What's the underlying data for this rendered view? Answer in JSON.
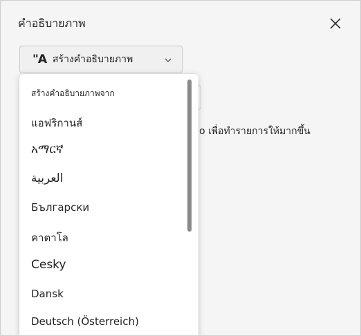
{
  "pane": {
    "title": "คำอธิบายภาพ",
    "close_icon": "close-icon"
  },
  "generate_button": {
    "icon_text": "\"A",
    "label": "สร้างคำอธิบายภาพ",
    "chevron_icon": "chevron-down-icon"
  },
  "background_text": "o เพื่อทำรายการให้มากขึ้น",
  "language_menu": {
    "header": "สร้างคำอธิบายภาพจาก",
    "items": [
      "แอฟริกานส์",
      "አማርኛ",
      "العربية",
      "Български",
      "คาตาโล",
      "Cesky",
      "Dansk",
      "Deutsch (Österreich)"
    ]
  }
}
